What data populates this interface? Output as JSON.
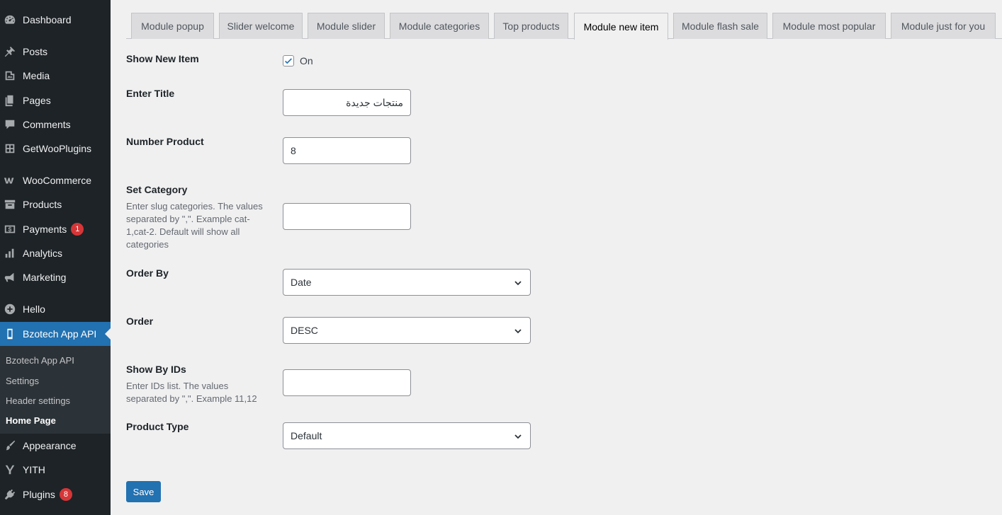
{
  "sidebar": {
    "items": [
      {
        "label": "Dashboard",
        "icon": "dashboard-icon"
      },
      {
        "label": "Posts",
        "icon": "pin-icon"
      },
      {
        "label": "Media",
        "icon": "media-icon"
      },
      {
        "label": "Pages",
        "icon": "pages-icon"
      },
      {
        "label": "Comments",
        "icon": "comment-icon"
      },
      {
        "label": "GetWooPlugins",
        "icon": "plugin-grid-icon"
      },
      {
        "label": "WooCommerce",
        "icon": "woo-icon"
      },
      {
        "label": "Products",
        "icon": "archive-icon"
      },
      {
        "label": "Payments",
        "icon": "money-icon",
        "badge": "1"
      },
      {
        "label": "Analytics",
        "icon": "bar-chart-icon"
      },
      {
        "label": "Marketing",
        "icon": "megaphone-icon"
      },
      {
        "label": "Hello",
        "icon": "plus-circle-icon"
      },
      {
        "label": "Bzotech App API",
        "icon": "phone-icon"
      },
      {
        "label": "Appearance",
        "icon": "brush-icon"
      },
      {
        "label": "YITH",
        "icon": "yith-icon"
      },
      {
        "label": "Plugins",
        "icon": "plug-icon",
        "badge": "8"
      }
    ],
    "submenu": [
      "Bzotech App API",
      "Settings",
      "Header settings",
      "Home Page"
    ]
  },
  "tabs": [
    "Module popup",
    "Slider welcome",
    "Module slider",
    "Module categories",
    "Top products",
    "Module new item",
    "Module flash sale",
    "Module most popular",
    "Module just for you"
  ],
  "active_tab": "Module new item",
  "form": {
    "show_new_item": {
      "label": "Show New Item",
      "checkbox_label": "On",
      "checked": true
    },
    "title": {
      "label": "Enter Title",
      "value": "منتجات جديدة"
    },
    "number_product": {
      "label": "Number Product",
      "value": "8"
    },
    "set_category": {
      "label": "Set Category",
      "description": "Enter slug categories. The values separated by \",\". Example cat-1,cat-2. Default will show all categories",
      "value": ""
    },
    "order_by": {
      "label": "Order By",
      "value": "Date"
    },
    "order": {
      "label": "Order",
      "value": "DESC"
    },
    "show_by_ids": {
      "label": "Show By IDs",
      "description": "Enter IDs list. The values separated by \",\". Example 11,12",
      "value": ""
    },
    "product_type": {
      "label": "Product Type",
      "value": "Default"
    }
  },
  "save_label": "Save",
  "colors": {
    "sidebar_bg": "#1d2327",
    "accent": "#2271b1",
    "badge": "#d63638",
    "page_bg": "#f0f0f1"
  }
}
